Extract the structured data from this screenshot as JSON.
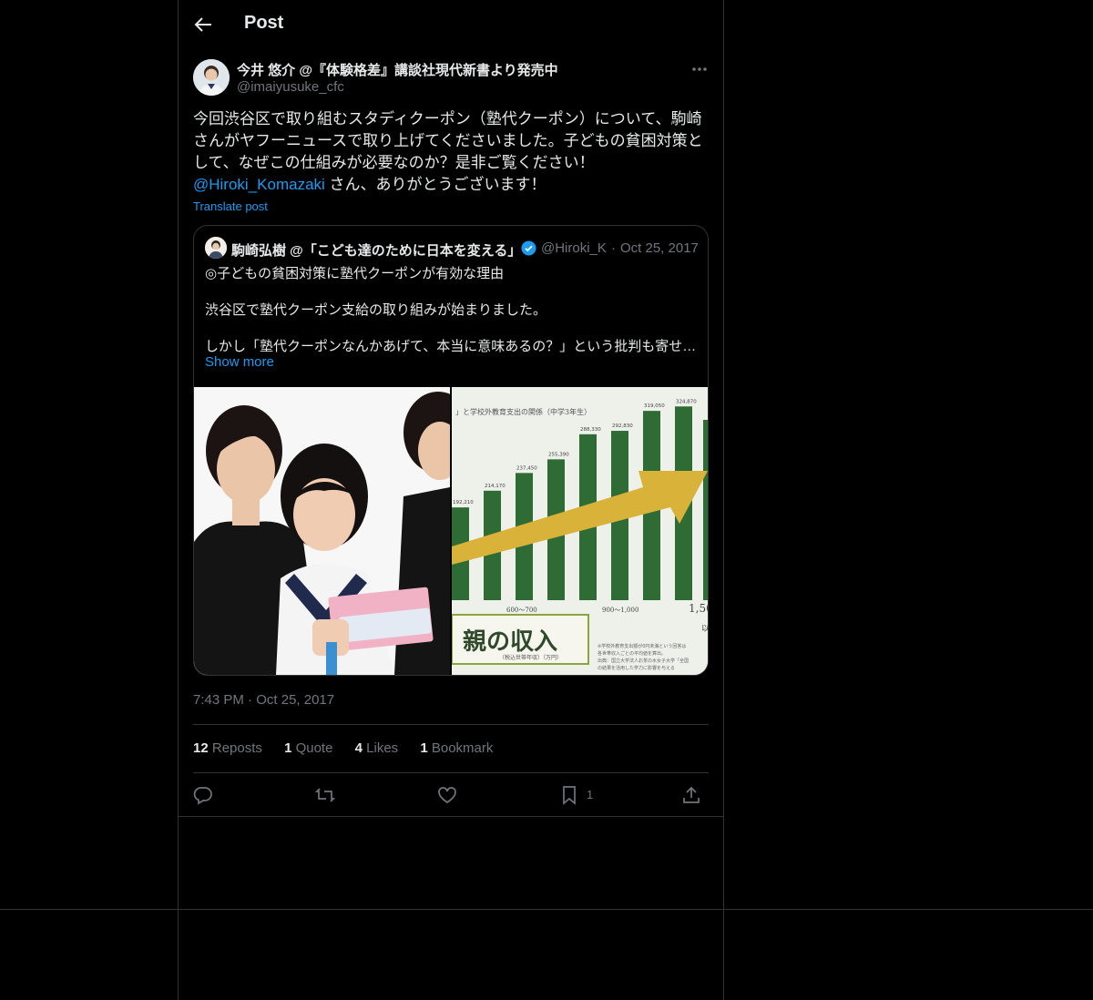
{
  "header": {
    "title": "Post"
  },
  "author": {
    "name": "今井 悠介 @『体験格差』講談社現代新書より発売中",
    "handle": "@imaiyusuke_cfc"
  },
  "post": {
    "lines": [
      "今回渋谷区で取り組むスタディクーポン（塾代クーポン）について、駒崎",
      "さんがヤフーニュースで取り上げてくださいました。子どもの貧困対策と",
      "して、なぜこの仕組みが必要なのか？是非ご覧ください！"
    ],
    "mention": "@Hiroki_Komazaki",
    "mention_tail": " さん、ありがとうございます！",
    "translate": "Translate post"
  },
  "quote": {
    "name": "駒崎弘樹 @「こども達のために日本を変える」",
    "handle": "@Hiroki_K",
    "date": "Oct 25, 2017",
    "lines": [
      "◎子どもの貧困対策に塾代クーポンが有効な理由",
      "渋谷区で塾代クーポン支給の取り組みが始まりました。",
      "しかし「塾代クーポンなんかあげて、本当に意味あるの？」という批判も寄せ…"
    ],
    "show_more": "Show more",
    "image2": {
      "title": "」と学校外教育支出の関係（中学3年生）",
      "bar_values": [
        "192,210",
        "214,170",
        "237,450",
        "255,390",
        "288,330",
        "292,830",
        "319,050",
        "324,870"
      ],
      "ticks": [
        "600～700",
        "900～1,000",
        "1,50"
      ],
      "tick_unit": "以",
      "caption": "親の収入",
      "caption_sub": "（税込世帯年収）（万円）",
      "note_lines": [
        "※学校外教育支出額が0円未満という回答は",
        "各世帯収入ごとの平均値を算出。",
        "出典：国立大学法人お茶の水女子大学「全国",
        "の結果を活用した学力に影響を与える"
      ]
    },
    "image2_bar_colors": {
      "bar": "#2f6b35",
      "arrow": "#d9b23a",
      "caption_border": "#8aa53c"
    }
  },
  "meta": {
    "time": "7:43 PM",
    "dot": "·",
    "date": "Oct 25, 2017"
  },
  "stats": {
    "reposts_count": "12",
    "reposts_label": "Reposts",
    "quotes_count": "1",
    "quotes_label": "Quote",
    "likes_count": "4",
    "likes_label": "Likes",
    "bookmarks_count": "1",
    "bookmarks_label": "Bookmark"
  },
  "actions": {
    "bookmark_count": "1"
  },
  "colors": {
    "accent": "#1d9bf0",
    "muted": "#71767b",
    "text": "#e7e9ea",
    "border": "#2f3336"
  }
}
